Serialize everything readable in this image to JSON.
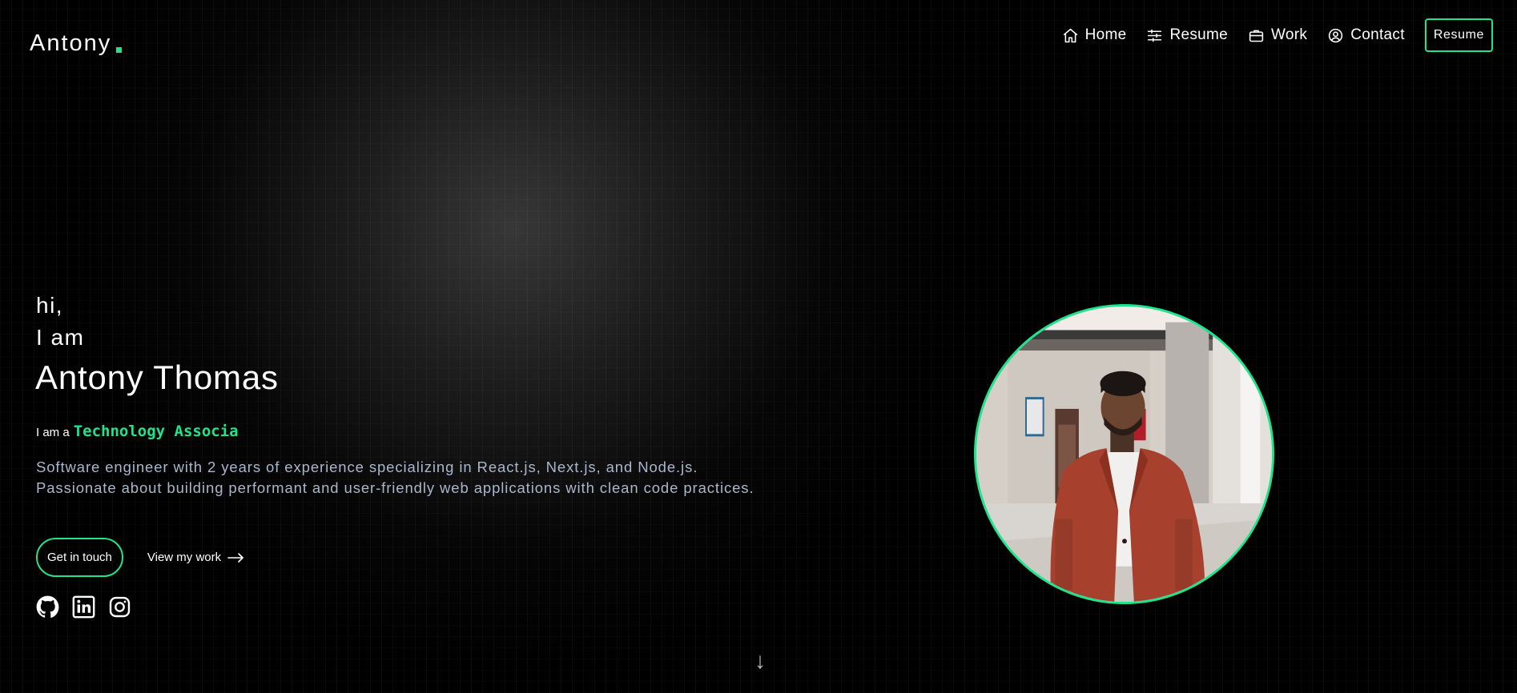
{
  "header": {
    "logo": "Antony",
    "nav": [
      {
        "label": "Home",
        "icon": "home-icon"
      },
      {
        "label": "Resume",
        "icon": "sliders-icon"
      },
      {
        "label": "Work",
        "icon": "briefcase-icon"
      },
      {
        "label": "Contact",
        "icon": "user-circle-icon"
      }
    ],
    "resume_button": "Resume"
  },
  "hero": {
    "greeting_line1": "hi,",
    "greeting_line2": "I am",
    "name": "Antony Thomas",
    "role_prefix": "I am a",
    "role_text": "Technology Associa",
    "bio": "Software engineer with 2 years of experience specializing in React.js, Next.js, and Node.js. Passionate about building performant and user-friendly web applications with clean code practices.",
    "get_in_touch": "Get in touch",
    "view_work": "View my work",
    "socials": [
      "github-icon",
      "linkedin-icon",
      "instagram-icon"
    ],
    "scroll_indicator": "↓"
  },
  "colors": {
    "accent": "#1ee48d",
    "bio_text": "#a9b6cc",
    "background": "#000000"
  }
}
